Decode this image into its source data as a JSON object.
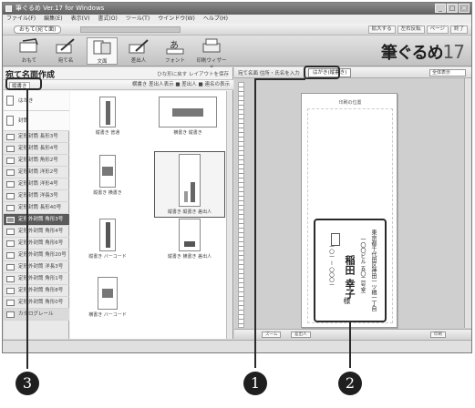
{
  "window": {
    "title": "筆ぐるめ Ver.17 for Windows"
  },
  "menubar": [
    "ファイル(F)",
    "編集(E)",
    "表示(V)",
    "書式(O)",
    "ツール(T)",
    "ウインドウ(W)",
    "ヘルプ(H)"
  ],
  "subtoolbar": {
    "back_label": "おもて(宛て面)",
    "right_buttons": [
      "拡大する",
      "左右反転",
      "ページ",
      "終了"
    ]
  },
  "ribbon": {
    "items": [
      {
        "label": "おもて",
        "icon": "postcard-front-icon"
      },
      {
        "label": "宛て名",
        "icon": "pen-address-icon"
      },
      {
        "label": "文面",
        "icon": "layout-icon"
      },
      {
        "label": "差出人",
        "icon": "sender-pen-icon"
      },
      {
        "label": "フォント",
        "icon": "font-icon"
      },
      {
        "label": "印刷ウィザード",
        "icon": "printer-icon"
      }
    ],
    "logo_text": "筆ぐるめ",
    "logo_version": "17"
  },
  "left_panel": {
    "title": "宛て名面作成",
    "title_links": "ひな形に戻す  レイアウトを保存",
    "select_button": "縦書き",
    "tools": "横書き  差出人表示  ■ 差出人 ■ 連名の表示"
  },
  "categories": [
    {
      "label": "はがき",
      "type": "big"
    },
    {
      "label": "封筒",
      "type": "big"
    },
    {
      "label": "定形封筒 長形3号",
      "type": "row"
    },
    {
      "label": "定形封筒 長形4号",
      "type": "row"
    },
    {
      "label": "定形封筒 角形2号",
      "type": "row"
    },
    {
      "label": "定形封筒 洋形2号",
      "type": "row"
    },
    {
      "label": "定形封筒 洋形4号",
      "type": "row"
    },
    {
      "label": "定形封筒 洋長3号",
      "type": "row"
    },
    {
      "label": "定形封筒 長形40号",
      "type": "row"
    },
    {
      "label": "定形外封筒 角形3号",
      "type": "selected"
    },
    {
      "label": "定形外封筒 角形4号",
      "type": "row"
    },
    {
      "label": "定形外封筒 角形6号",
      "type": "row"
    },
    {
      "label": "定形外封筒 角形20号",
      "type": "row"
    },
    {
      "label": "定形外封筒 洋長3号",
      "type": "row"
    },
    {
      "label": "定形外封筒 角形1号",
      "type": "row"
    },
    {
      "label": "定形外封筒 角形8号",
      "type": "row"
    },
    {
      "label": "定形外封筒 角形0号",
      "type": "row"
    },
    {
      "label": "カタログレール",
      "type": "dark"
    }
  ],
  "thumbnails": [
    {
      "caption": "縦書き 普通",
      "selected": false
    },
    {
      "caption": "横書き 縦書き",
      "selected": false
    },
    {
      "caption": "縦書き 横書き",
      "selected": false
    },
    {
      "caption": "縦書き 縦書き 差出人",
      "selected": true
    },
    {
      "caption": "縦書き バーコード",
      "selected": false
    },
    {
      "caption": "縦書き 横書き 差出人",
      "selected": false
    },
    {
      "caption": "横書き バーコード",
      "selected": false
    }
  ],
  "right_panel": {
    "toolbar_label": "宛て名面 住所・氏名を入力",
    "postcard_label": "はがき(縦書き)",
    "zoom_dropdown": "全体表示",
    "postcard_heading": "印刷の位置",
    "address_line1": "東京都千代田区神田一ツ橋一丁目",
    "address_line2": "一〇〇ビル 五〇二号室",
    "postal_code": "一〇一 ー 〇〇〇一",
    "recipient_name": "稲田 幸子",
    "honorific": "様",
    "status_buttons": [
      "ズーム",
      "差出人",
      "印刷"
    ]
  },
  "callouts": [
    "1",
    "2",
    "3"
  ]
}
